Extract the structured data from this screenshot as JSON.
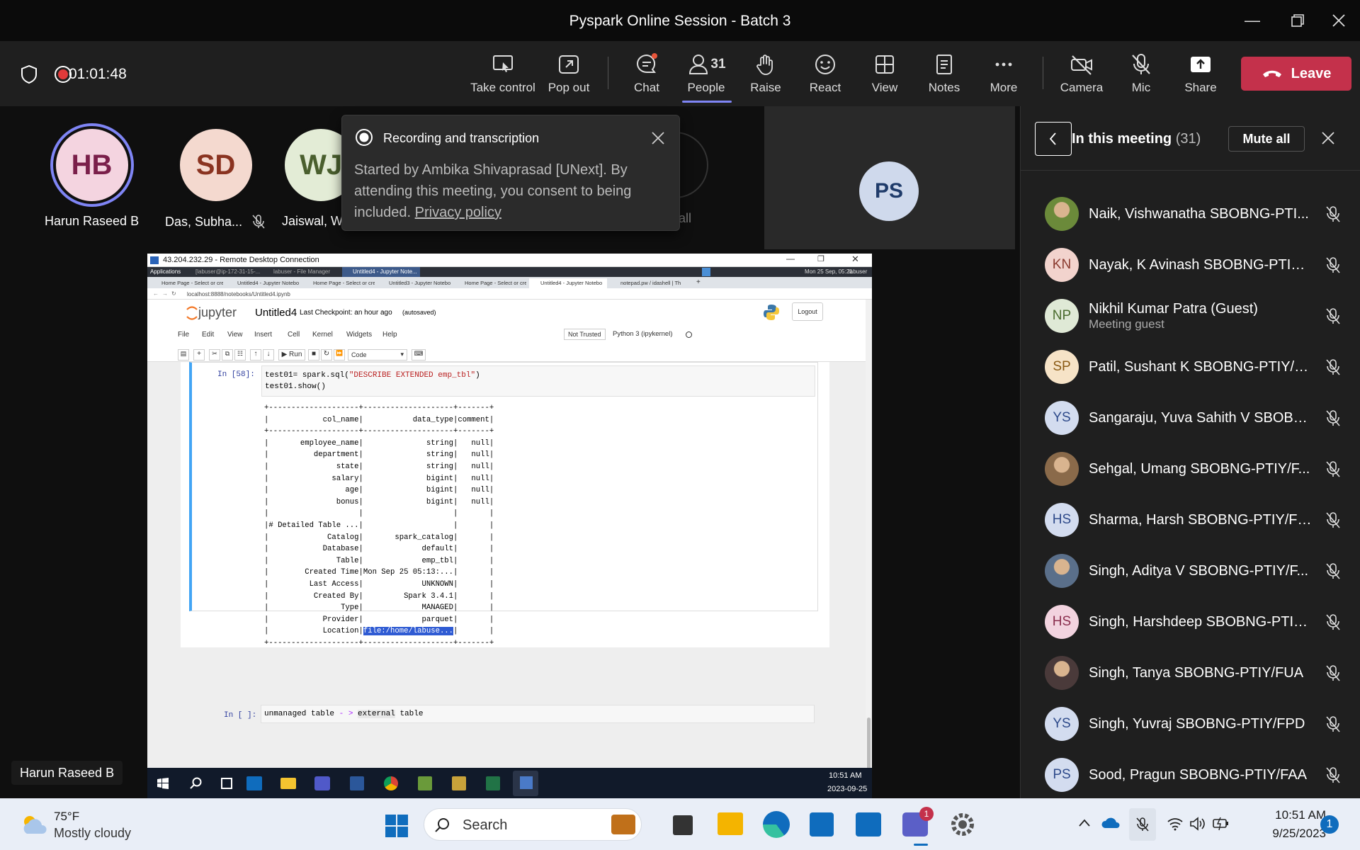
{
  "window": {
    "title": "Pyspark Online Session - Batch 3"
  },
  "meeting": {
    "timer": "01:01:48"
  },
  "toolbar": {
    "take_control": "Take control",
    "pop_out": "Pop out",
    "chat": "Chat",
    "people": "People",
    "people_count": "31",
    "raise": "Raise",
    "react": "React",
    "view": "View",
    "notes": "Notes",
    "more": "More",
    "camera": "Camera",
    "mic": "Mic",
    "share": "Share",
    "leave": "Leave"
  },
  "stage": {
    "tiles": [
      {
        "initials": "HB",
        "name": "Harun Raseed B"
      },
      {
        "initials": "SD",
        "name": "Das, Subha..."
      },
      {
        "initials": "WJ",
        "name": "Jaiswal, Wa..."
      }
    ],
    "hidden_fragment": "all",
    "ps_initials": "PS",
    "speaker_label": "Harun Raseed B"
  },
  "popup": {
    "title": "Recording and transcription",
    "body": "Started by Ambika Shivaprasad [UNext]. By attending this meeting, you consent to being included.",
    "link": "Privacy policy"
  },
  "panel": {
    "title": "In this meeting",
    "count": "(31)",
    "mute_all": "Mute all",
    "participants": [
      {
        "initials": "",
        "name": "Naik, Vishwanatha SBOBNG-PTI...",
        "sub": "",
        "photo": true,
        "color": "#6b8a3a"
      },
      {
        "initials": "KN",
        "name": "Nayak, K Avinash SBOBNG-PTIY/...",
        "sub": "",
        "photo": false,
        "color": "#f2d3cd",
        "fg": "#8a3a2e"
      },
      {
        "initials": "NP",
        "name": "Nikhil Kumar Patra (Guest)",
        "sub": "Meeting guest",
        "photo": false,
        "color": "#dfe9d6",
        "fg": "#4a6b2e"
      },
      {
        "initials": "SP",
        "name": "Patil, Sushant K SBOBNG-PTIY/F...",
        "sub": "",
        "photo": false,
        "color": "#f6e3c7",
        "fg": "#8a5a14"
      },
      {
        "initials": "YS",
        "name": "Sangaraju, Yuva Sahith V SBOBN...",
        "sub": "",
        "photo": false,
        "color": "#d3dcef",
        "fg": "#2e4a8a"
      },
      {
        "initials": "",
        "name": "Sehgal, Umang SBOBNG-PTIY/F...",
        "sub": "",
        "photo": true,
        "color": "#8a6a4a"
      },
      {
        "initials": "HS",
        "name": "Sharma, Harsh SBOBNG-PTIY/FUG",
        "sub": "",
        "photo": false,
        "color": "#d3dcef",
        "fg": "#2e4a8a"
      },
      {
        "initials": "",
        "name": "Singh, Aditya V SBOBNG-PTIY/F...",
        "sub": "",
        "photo": true,
        "color": "#5a6f8a"
      },
      {
        "initials": "HS",
        "name": "Singh, Harshdeep SBOBNG-PTIY...",
        "sub": "",
        "photo": false,
        "color": "#f2d3df",
        "fg": "#8a2e4e"
      },
      {
        "initials": "",
        "name": "Singh, Tanya SBOBNG-PTIY/FUA",
        "sub": "",
        "photo": true,
        "color": "#4a3a3a"
      },
      {
        "initials": "YS",
        "name": "Singh, Yuvraj SBOBNG-PTIY/FPD",
        "sub": "",
        "photo": false,
        "color": "#d3dcef",
        "fg": "#2e4a8a"
      },
      {
        "initials": "PS",
        "name": "Sood, Pragun SBOBNG-PTIY/FAA",
        "sub": "",
        "photo": false,
        "color": "#d3dcef",
        "fg": "#2e4a8a"
      }
    ]
  },
  "rdp": {
    "title": "43.204.232.29 - Remote Desktop Connection",
    "apps_label": "Applications",
    "top_tasks": [
      "[labuser@ip-172-31-15-...",
      "labuser - File Manager",
      "Untitled4 - Jupyter Note..."
    ],
    "top_clock": "Mon 25 Sep, 05:21",
    "top_user": "labuser",
    "tabs": [
      "Home Page - Select or cre",
      "Untitled4 - Jupyter Notebo",
      "Home Page - Select or cre",
      "Untitled3 - Jupyter Notebo",
      "Home Page - Select or cre",
      "Untitled4 - Jupyter Notebo",
      "notepad.pw / idashell | Th"
    ],
    "url": "localhost:8888/notebooks/Untitled4.ipynb",
    "jupyter": {
      "brand": "jupyter",
      "notebook": "Untitled4",
      "checkpoint": "Last Checkpoint: an hour ago",
      "autosaved": "(autosaved)",
      "logout": "Logout",
      "menus": [
        "File",
        "Edit",
        "View",
        "Insert",
        "Cell",
        "Kernel",
        "Widgets",
        "Help"
      ],
      "trust": "Not Trusted",
      "kernel": "Python 3 (ipykernel)",
      "run": "Run",
      "cell_type": "Code"
    },
    "cell1": {
      "prompt": "In [58]:",
      "line1_a": "test01= spark.sql(",
      "line1_s": "\"DESCRIBE EXTENDED emp_tbl\"",
      "line1_b": ")",
      "line2": "test01.show()"
    },
    "output": [
      "+--------------------+--------------------+-------+",
      "|            col_name|           data_type|comment|",
      "+--------------------+--------------------+-------+",
      "|       employee_name|              string|   null|",
      "|          department|              string|   null|",
      "|               state|              string|   null|",
      "|              salary|              bigint|   null|",
      "|                 age|              bigint|   null|",
      "|               bonus|              bigint|   null|",
      "|                    |                    |       |",
      "|# Detailed Table ...|                    |       |",
      "|             Catalog|       spark_catalog|       |",
      "|            Database|             default|       |",
      "|               Table|             emp_tbl|       |",
      "|        Created Time|Mon Sep 25 05:13:...|       |",
      "|         Last Access|             UNKNOWN|       |",
      "|          Created By|         Spark 3.4.1|       |",
      "|                Type|             MANAGED|       |",
      "|            Provider|             parquet|       |",
      "|            Location|file:/home/labuse...|       |",
      "+--------------------+--------------------+-------+"
    ],
    "cell2": {
      "prompt": "In [ ]:",
      "a": "unmanaged table ",
      "op": "- >",
      "b": " ",
      "ext": "external",
      "c": " table"
    },
    "clock_time": "10:51 AM",
    "clock_date": "2023-09-25"
  },
  "taskbar": {
    "temp": "75°F",
    "weather": "Mostly cloudy",
    "search": "Search",
    "teams_badge": "1",
    "time": "10:51 AM",
    "date": "9/25/2023",
    "notif": "1"
  }
}
